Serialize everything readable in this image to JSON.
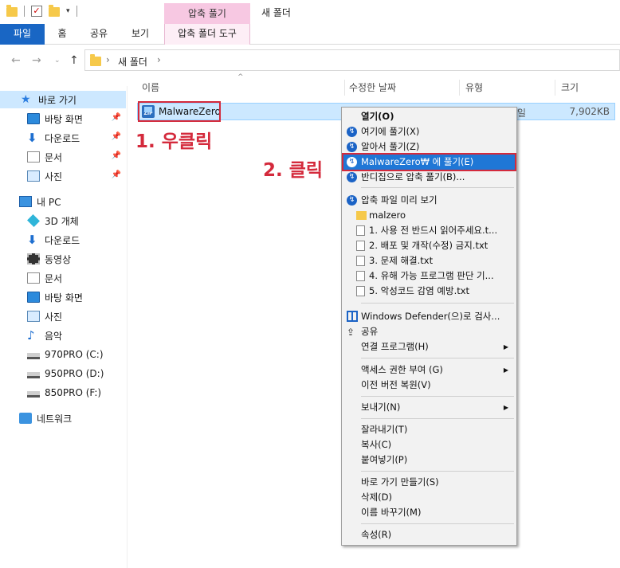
{
  "window": {
    "title": "새 폴더",
    "context_group": "압축 풀기"
  },
  "ribbon": {
    "tabs": [
      "파일",
      "홈",
      "공유",
      "보기",
      "압축 폴더 도구"
    ]
  },
  "address": {
    "path": [
      "새 폴더"
    ]
  },
  "nav": {
    "quick_access": "바로 가기",
    "quick_items": [
      "바탕 화면",
      "다운로드",
      "문서",
      "사진"
    ],
    "this_pc": "내 PC",
    "pc_items": [
      "3D 개체",
      "다운로드",
      "동영상",
      "문서",
      "바탕 화면",
      "사진",
      "음악",
      "970PRO (C:)",
      "950PRO (D:)",
      "850PRO (F:)"
    ],
    "network": "네트워크"
  },
  "columns": {
    "name": "이름",
    "modified": "수정한 날짜",
    "type": "유형",
    "size": "크기"
  },
  "file": {
    "name": "MalwareZero",
    "type_partial": "일",
    "size": "7,902KB"
  },
  "annotations": {
    "step1": "1. 우클릭",
    "step2": "2. 클릭"
  },
  "menu": {
    "open": "열기(O)",
    "extract_here": "여기에 풀기(X)",
    "extract_auto": "알아서 풀기(Z)",
    "extract_to": "MalwareZero₩ 에 풀기(E)",
    "bandizip_compress": "반디집으로 압축 풀기(B)...",
    "preview": "압축 파일 미리 보기",
    "preview_items": [
      "malzero",
      "1. 사용 전 반드시 읽어주세요.t...",
      "2. 배포 및 개작(수정) 금지.txt",
      "3. 문제 해결.txt",
      "4. 유해 가능 프로그램 판단 기...",
      "5. 악성코드 감염 예방.txt"
    ],
    "defender": "Windows Defender(으)로 검사...",
    "share": "공유",
    "open_with": "연결 프로그램(H)",
    "give_access": "액세스 권한 부여 (G)",
    "restore": "이전 버전 복원(V)",
    "send_to": "보내기(N)",
    "cut": "잘라내기(T)",
    "copy": "복사(C)",
    "paste": "붙여넣기(P)",
    "shortcut": "바로 가기 만들기(S)",
    "delete": "삭제(D)",
    "rename": "이름 바꾸기(M)",
    "properties": "속성(R)"
  }
}
